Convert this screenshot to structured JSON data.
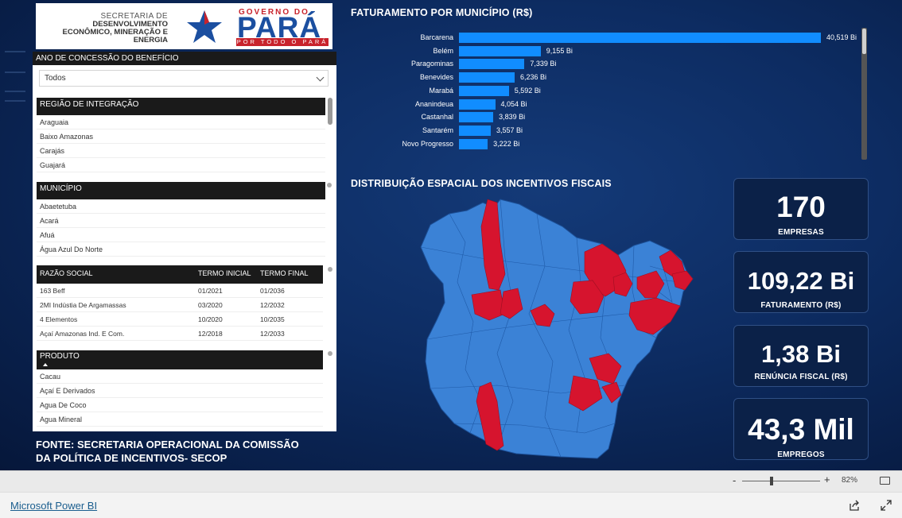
{
  "logo": {
    "secretaria_line1": "SECRETARIA DE",
    "secretaria_line2": "DESENVOLVIMENTO",
    "secretaria_line3": "ECONÔMICO, MINERAÇÃO E",
    "secretaria_line4": "ENERGIA",
    "governo": "GOVERNO DO",
    "para": "PARÁ",
    "tagline": "POR TODO O PARÁ"
  },
  "filters": {
    "year_header": "ANO DE CONCESSÃO DO BENEFÍCIO",
    "year_value": "Todos",
    "regiao": {
      "header": "REGIÃO DE INTEGRAÇÃO",
      "items": [
        "Araguaia",
        "Baixo Amazonas",
        "Carajás",
        "Guajará"
      ]
    },
    "municipio": {
      "header": "MUNICÍPIO",
      "items": [
        "Abaetetuba",
        "Acará",
        "Afuá",
        "Água Azul Do Norte"
      ]
    },
    "razao": {
      "columns": [
        "RAZÃO SOCIAL",
        "TERMO INICIAL",
        "TERMO FINAL"
      ],
      "rows": [
        [
          "163 Beff",
          "01/2021",
          "01/2036"
        ],
        [
          "2MI Indústia De Argamassas",
          "03/2020",
          "12/2032"
        ],
        [
          "4 Elementos",
          "10/2020",
          "10/2035"
        ],
        [
          "Açaí Amazonas Ind. E Com.",
          "12/2018",
          "12/2033"
        ]
      ]
    },
    "produto": {
      "header": "PRODUTO",
      "items": [
        "Cacau",
        "Açaí E Derivados",
        "Agua De Coco",
        "Agua Mineral"
      ]
    }
  },
  "fonte": "FONTE: SECRETARIA OPERACIONAL DA COMISSÃO DA POLÍTICA DE INCENTIVOS- SECOP",
  "bar_title": "FATURAMENTO POR MUNICÍPIO (R$)",
  "map_title": "DISTRIBUIÇÃO ESPACIAL DOS INCENTIVOS FISCAIS",
  "chart_data": {
    "type": "bar",
    "orientation": "horizontal",
    "title": "FATURAMENTO POR MUNICÍPIO (R$)",
    "categories": [
      "Barcarena",
      "Belém",
      "Paragominas",
      "Benevides",
      "Marabá",
      "Ananindeua",
      "Castanhal",
      "Santarém",
      "Novo Progresso"
    ],
    "values": [
      40.519,
      9.155,
      7.339,
      6.236,
      5.592,
      4.054,
      3.839,
      3.557,
      3.222
    ],
    "labels": [
      "40,519 Bi",
      "9,155 Bi",
      "7,339 Bi",
      "6,236 Bi",
      "5,592 Bi",
      "4,054 Bi",
      "3,839 Bi",
      "3,557 Bi",
      "3,222 Bi"
    ],
    "color": "#118dff"
  },
  "map_colors": {
    "incentivized": "#d6142e",
    "other": "#3b82d6"
  },
  "kpis": {
    "empresas": {
      "value": "170",
      "label": "EMPRESAS"
    },
    "faturamento": {
      "value": "109,22 Bi",
      "label": "FATURAMENTO (R$)"
    },
    "renuncia": {
      "value": "1,38 Bi",
      "label": "RENÚNCIA FISCAL (R$)"
    },
    "empregos": {
      "value": "43,3 Mil",
      "label": "EMPREGOS"
    }
  },
  "zoom": {
    "minus": "-",
    "plus": "+",
    "percent": "82%"
  },
  "footer": {
    "link": "Microsoft Power BI"
  }
}
